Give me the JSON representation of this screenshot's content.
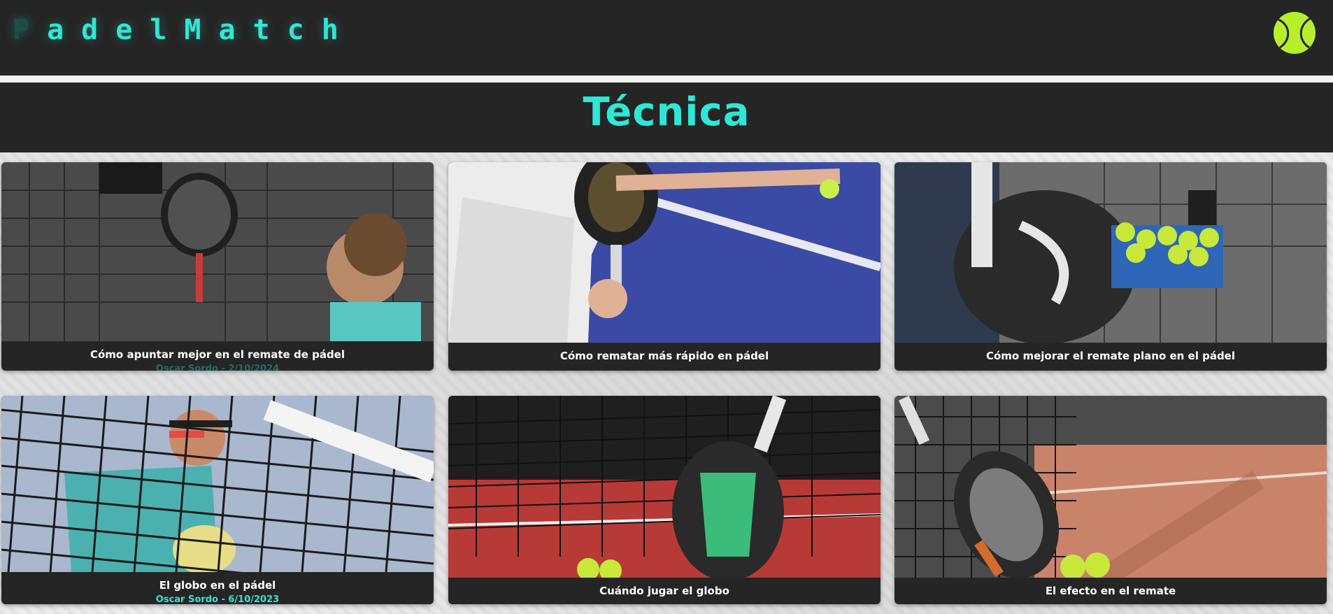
{
  "brand": {
    "name_prefix": "Padel",
    "name_suffix": "Match"
  },
  "header_icon": "tennis-ball-icon",
  "section": {
    "title": "Técnica"
  },
  "colors": {
    "accent": "#2ee8d6",
    "dark": "#252525",
    "ball": "#b7f02a"
  },
  "articles": [
    {
      "title": "Cómo apuntar mejor en el remate de pádel",
      "meta": "Oscar Sordo - 2/10/2024"
    },
    {
      "title": "Cómo rematar más rápido en pádel"
    },
    {
      "title": "Cómo mejorar el remate plano en el pádel"
    },
    {
      "title": "El globo en el pádel",
      "meta": "Oscar Sordo - 6/10/2023"
    },
    {
      "title": "Cuándo jugar el globo"
    },
    {
      "title": "El efecto en el remate"
    }
  ]
}
